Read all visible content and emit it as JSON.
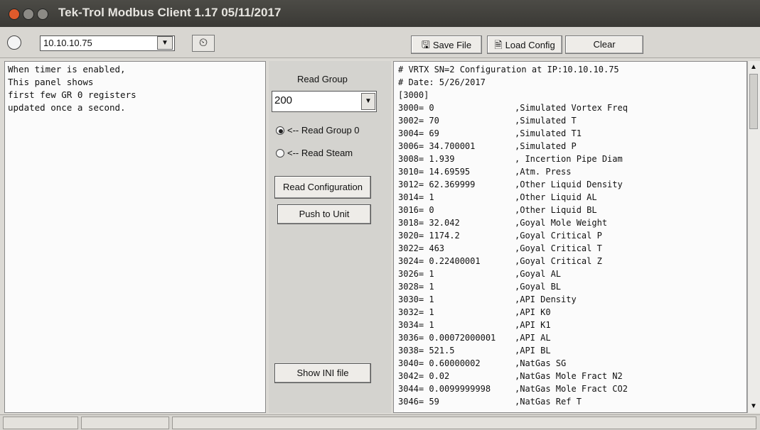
{
  "window": {
    "title": "Tek-Trol Modbus Client 1.17 05/11/2017"
  },
  "toolbar": {
    "ip_address": "10.10.10.75",
    "save_file": "Save File",
    "load_config": "Load Config",
    "clear": "Clear"
  },
  "left_panel": {
    "text": "When timer is enabled,\nThis panel shows\nfirst few GR 0 registers\nupdated once a second."
  },
  "middle_panel": {
    "read_group_label": "Read Group",
    "read_group_value": "200",
    "radio_read_group_0": "<-- Read Group 0",
    "radio_read_steam": "<-- Read Steam",
    "read_configuration": "Read Configuration",
    "push_to_unit": "Push to Unit",
    "show_ini_file": "Show INI file"
  },
  "config": {
    "header_lines": [
      "# VRTX SN=2 Configuration at IP:10.10.10.75",
      "# Date: 5/26/2017",
      "[3000]"
    ],
    "rows": [
      {
        "reg": "3000= 0",
        "desc": ",Simulated Vortex Freq"
      },
      {
        "reg": "3002= 70",
        "desc": ",Simulated T"
      },
      {
        "reg": "3004= 69",
        "desc": ",Simulated T1"
      },
      {
        "reg": "3006= 34.700001",
        "desc": ",Simulated P"
      },
      {
        "reg": "3008= 1.939",
        "desc": ", Incertion Pipe Diam"
      },
      {
        "reg": "3010= 14.69595",
        "desc": ",Atm. Press"
      },
      {
        "reg": "3012= 62.369999",
        "desc": ",Other Liquid Density"
      },
      {
        "reg": "3014= 1",
        "desc": ",Other Liquid AL"
      },
      {
        "reg": "3016= 0",
        "desc": ",Other Liquid BL"
      },
      {
        "reg": "3018= 32.042",
        "desc": ",Goyal Mole Weight"
      },
      {
        "reg": "3020= 1174.2",
        "desc": ",Goyal Critical P"
      },
      {
        "reg": "3022= 463",
        "desc": ",Goyal Critical T"
      },
      {
        "reg": "3024= 0.22400001",
        "desc": ",Goyal Critical Z"
      },
      {
        "reg": "3026= 1",
        "desc": ",Goyal AL"
      },
      {
        "reg": "3028= 1",
        "desc": ",Goyal BL"
      },
      {
        "reg": "3030= 1",
        "desc": ",API Density"
      },
      {
        "reg": "3032= 1",
        "desc": ",API K0"
      },
      {
        "reg": "3034= 1",
        "desc": ",API K1"
      },
      {
        "reg": "3036= 0.00072000001",
        "desc": ",API AL"
      },
      {
        "reg": "3038= 521.5",
        "desc": ",API BL"
      },
      {
        "reg": "3040= 0.60000002",
        "desc": ",NatGas SG"
      },
      {
        "reg": "3042= 0.02",
        "desc": ",NatGas Mole Fract N2"
      },
      {
        "reg": "3044= 0.0099999998",
        "desc": ",NatGas Mole Fract CO2"
      },
      {
        "reg": "3046= 59",
        "desc": ",NatGas Ref T"
      }
    ]
  },
  "icons": {
    "timer": "timer-icon",
    "save": "save-file-icon",
    "load": "load-config-icon"
  },
  "colors": {
    "titlebar": "#3f3e3a",
    "close_button": "#e05a2b",
    "other_buttons": "#8c8a85",
    "panel_bg": "#fbfbfb",
    "window_bg": "#dcdad5"
  }
}
